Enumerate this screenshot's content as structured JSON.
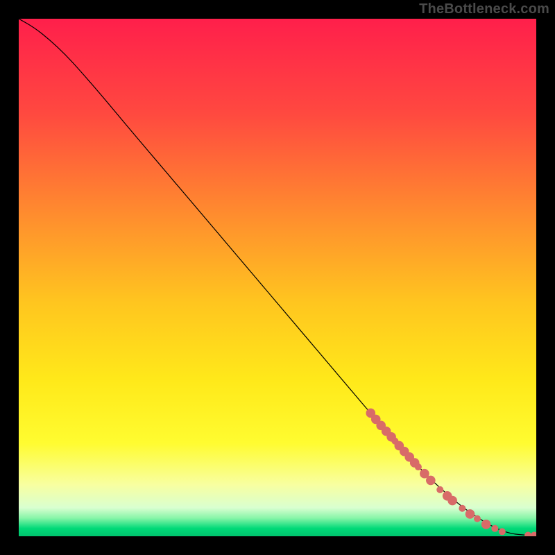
{
  "watermark": "TheBottleneck.com",
  "chart_data": {
    "type": "line",
    "title": "",
    "xlabel": "",
    "ylabel": "",
    "xlim": [
      0,
      100
    ],
    "ylim": [
      0,
      100
    ],
    "grid": false,
    "legend": false,
    "background_gradient_stops": [
      {
        "offset": 0.0,
        "color": "#ff1f4b"
      },
      {
        "offset": 0.18,
        "color": "#ff4840"
      },
      {
        "offset": 0.38,
        "color": "#ff8d2e"
      },
      {
        "offset": 0.55,
        "color": "#ffc61f"
      },
      {
        "offset": 0.7,
        "color": "#ffe91a"
      },
      {
        "offset": 0.82,
        "color": "#fffc30"
      },
      {
        "offset": 0.9,
        "color": "#f8ffa0"
      },
      {
        "offset": 0.945,
        "color": "#d9ffd0"
      },
      {
        "offset": 0.965,
        "color": "#87f5a8"
      },
      {
        "offset": 0.985,
        "color": "#00d978"
      },
      {
        "offset": 1.0,
        "color": "#00c46e"
      }
    ],
    "series": [
      {
        "name": "curve",
        "color": "#000000",
        "stroke_width": 1.2,
        "points": [
          {
            "x": 0.0,
            "y": 100.0
          },
          {
            "x": 3.0,
            "y": 98.3
          },
          {
            "x": 6.0,
            "y": 95.9
          },
          {
            "x": 9.0,
            "y": 93.1
          },
          {
            "x": 12.0,
            "y": 89.8
          },
          {
            "x": 16.0,
            "y": 85.2
          },
          {
            "x": 22.0,
            "y": 78.0
          },
          {
            "x": 30.0,
            "y": 68.6
          },
          {
            "x": 40.0,
            "y": 56.8
          },
          {
            "x": 50.0,
            "y": 45.0
          },
          {
            "x": 60.0,
            "y": 33.2
          },
          {
            "x": 70.0,
            "y": 21.4
          },
          {
            "x": 78.0,
            "y": 12.5
          },
          {
            "x": 84.0,
            "y": 7.0
          },
          {
            "x": 88.0,
            "y": 4.0
          },
          {
            "x": 92.0,
            "y": 1.6
          },
          {
            "x": 95.0,
            "y": 0.5
          },
          {
            "x": 98.0,
            "y": 0.2
          },
          {
            "x": 100.0,
            "y": 0.2
          }
        ]
      },
      {
        "name": "highlight-dots",
        "color": "#d86b68",
        "style": "scatter",
        "radius_major": 6.8,
        "radius_minor": 5.0,
        "points": [
          {
            "x": 68.0,
            "y": 23.8,
            "r": 6.8
          },
          {
            "x": 69.0,
            "y": 22.6,
            "r": 6.8
          },
          {
            "x": 70.0,
            "y": 21.4,
            "r": 6.8
          },
          {
            "x": 71.0,
            "y": 20.3,
            "r": 6.8
          },
          {
            "x": 72.0,
            "y": 19.2,
            "r": 6.8
          },
          {
            "x": 72.7,
            "y": 18.4,
            "r": 5.0
          },
          {
            "x": 73.5,
            "y": 17.5,
            "r": 6.8
          },
          {
            "x": 74.5,
            "y": 16.4,
            "r": 6.8
          },
          {
            "x": 75.5,
            "y": 15.3,
            "r": 6.8
          },
          {
            "x": 76.5,
            "y": 14.2,
            "r": 6.8
          },
          {
            "x": 77.2,
            "y": 13.4,
            "r": 5.0
          },
          {
            "x": 78.4,
            "y": 12.1,
            "r": 6.8
          },
          {
            "x": 79.6,
            "y": 10.8,
            "r": 6.8
          },
          {
            "x": 81.4,
            "y": 9.0,
            "r": 5.0
          },
          {
            "x": 82.8,
            "y": 7.8,
            "r": 6.8
          },
          {
            "x": 83.8,
            "y": 6.9,
            "r": 6.8
          },
          {
            "x": 85.7,
            "y": 5.4,
            "r": 5.0
          },
          {
            "x": 87.2,
            "y": 4.3,
            "r": 6.8
          },
          {
            "x": 88.6,
            "y": 3.4,
            "r": 5.0
          },
          {
            "x": 90.3,
            "y": 2.3,
            "r": 6.8
          },
          {
            "x": 92.0,
            "y": 1.5,
            "r": 5.0
          },
          {
            "x": 93.4,
            "y": 0.9,
            "r": 5.0
          },
          {
            "x": 98.4,
            "y": 0.2,
            "r": 5.0
          },
          {
            "x": 99.6,
            "y": 0.2,
            "r": 5.0
          }
        ]
      }
    ]
  }
}
